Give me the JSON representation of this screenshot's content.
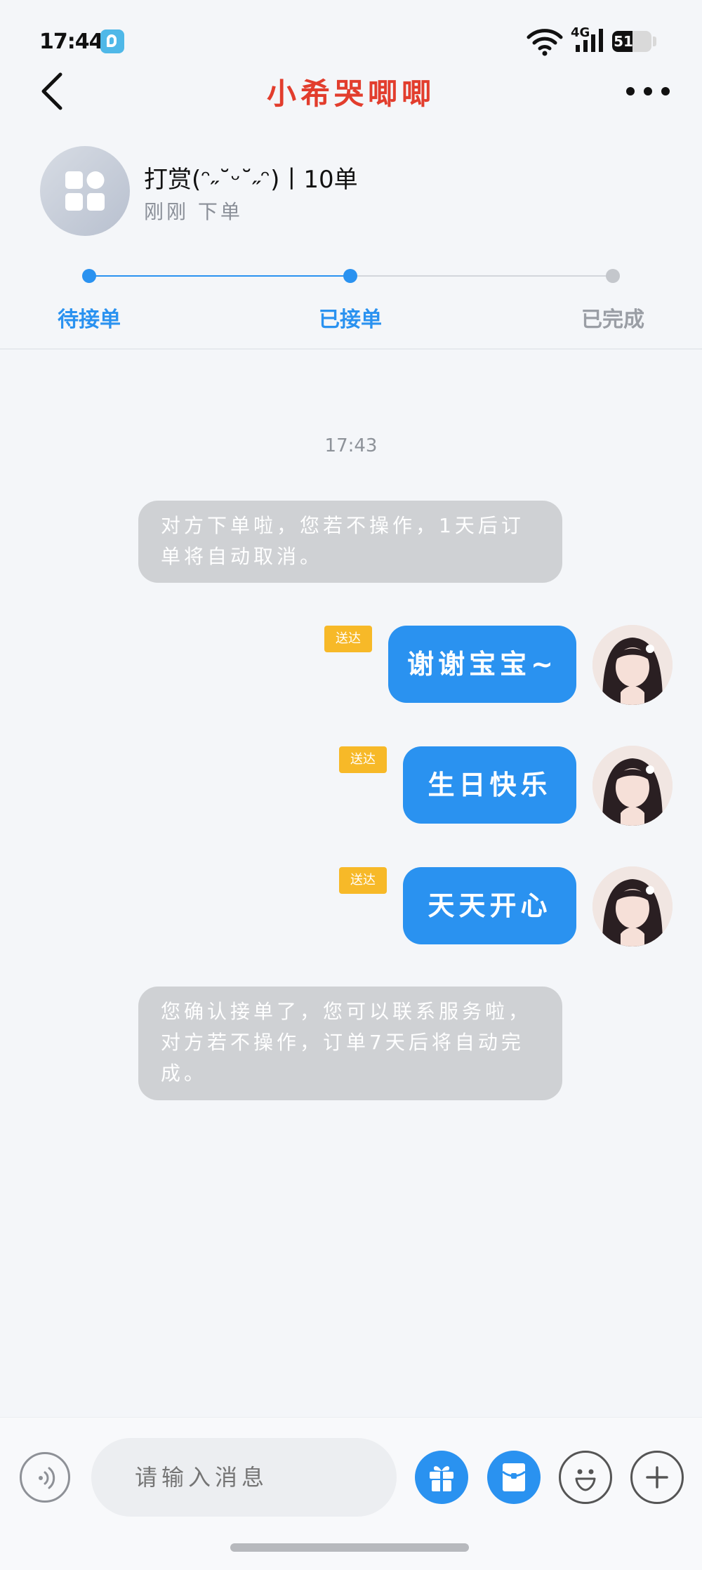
{
  "status_bar": {
    "time": "17:44",
    "network": "4G",
    "battery": "51",
    "battery_level_percent": 51,
    "app_icon": "app-b-icon"
  },
  "nav": {
    "title": "小希哭唧唧",
    "back_icon": "chevron-left-icon",
    "more_icon": "more-dots-icon"
  },
  "order": {
    "title": "打赏(ᵔ˶˘ᵕ˘˶ᵔ)丨10单",
    "subtitle": "刚刚 下单",
    "icon": "apps-grid-icon"
  },
  "progress": {
    "steps": [
      {
        "label": "待接单",
        "state": "done"
      },
      {
        "label": "已接单",
        "state": "current"
      },
      {
        "label": "已完成",
        "state": "pending"
      }
    ]
  },
  "colors": {
    "accent": "#2a92f0",
    "title_red": "#e23d2d",
    "delivered": "#f7b928",
    "system_bubble": "#cfd1d4"
  },
  "chat": {
    "time": "17:43",
    "system_1": "对方下单啦，您若不操作，1天后订单将自动取消。",
    "messages": [
      {
        "text": "谢谢宝宝~",
        "status": "送达"
      },
      {
        "text": "生日快乐",
        "status": "送达"
      },
      {
        "text": "天天开心",
        "status": "送达"
      }
    ],
    "system_2": "您确认接单了，您可以联系服务啦，对方若不操作，订单7天后将自动完成。"
  },
  "input": {
    "placeholder": "请输入消息",
    "voice_icon": "voice-icon",
    "gift_icon": "gift-icon",
    "red_packet_icon": "red-packet-icon",
    "emoji_icon": "emoji-icon",
    "plus_icon": "plus-icon"
  }
}
